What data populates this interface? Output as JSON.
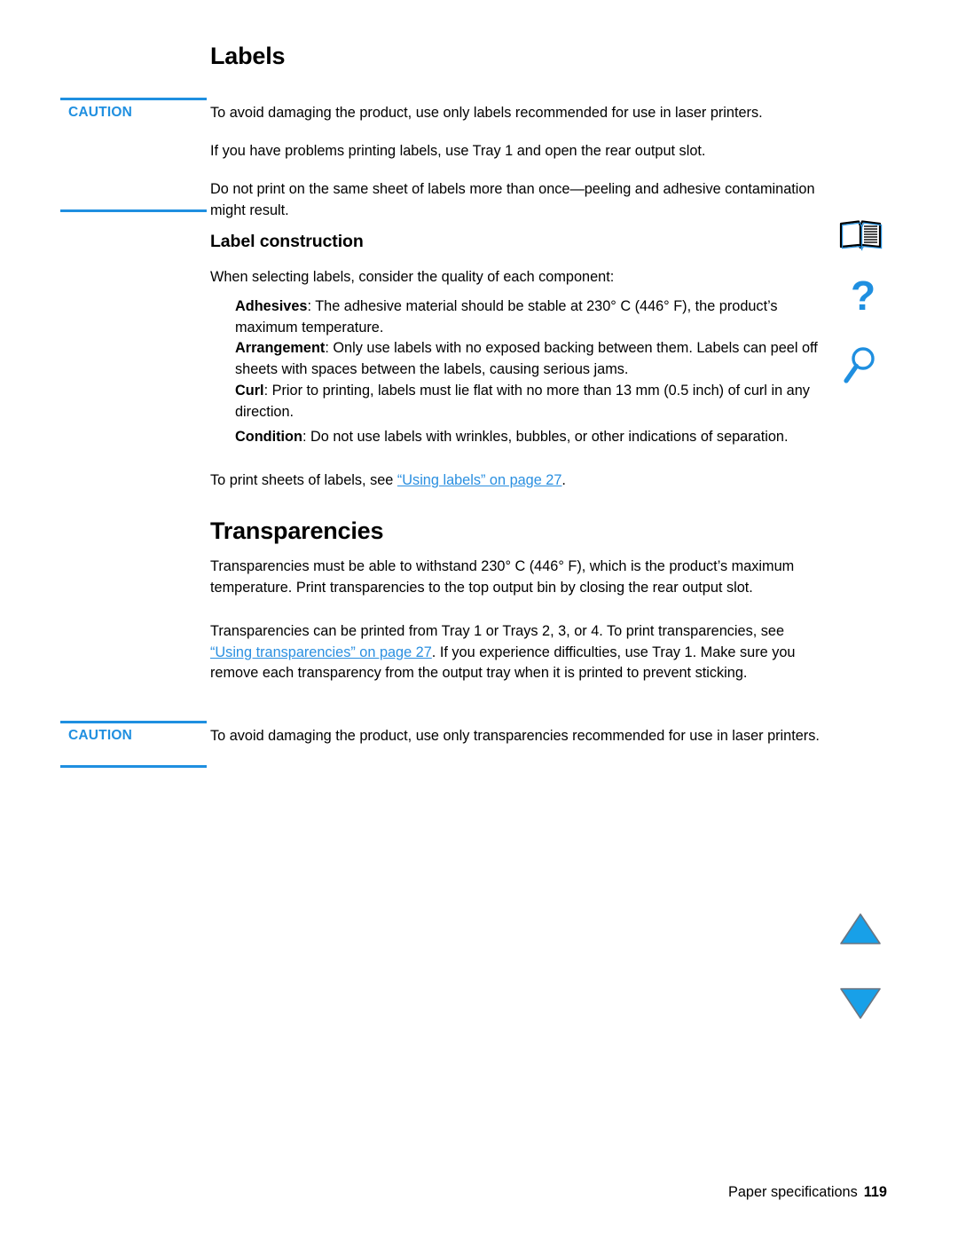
{
  "document": {
    "headings": {
      "labels": "Labels",
      "label_construction": "Label construction",
      "transparencies": "Transparencies"
    },
    "caution": {
      "label": "CAUTION",
      "labels_section_text": "To avoid damaging the product, use only labels recommended for use in laser printers.",
      "transparencies_section_text": "To avoid damaging the product, use only transparencies recommended for use in laser printers."
    },
    "labels_section": {
      "paragraph_tray": "If you have problems printing labels, use Tray 1 and open the rear output slot.",
      "paragraph_reprint": "Do not print on the same sheet of labels more than once—peeling and adhesive contamination might result.",
      "construction_intro": "When selecting labels, consider the quality of each component:",
      "definitions": [
        {
          "term": "Adhesives",
          "text": ": The adhesive material should be stable at 230° C (446° F), the product’s maximum temperature."
        },
        {
          "term": "Arrangement",
          "text": ": Only use labels with no exposed backing between them. Labels can peel off sheets with spaces between the labels, causing serious jams."
        },
        {
          "term": "Curl",
          "text": ": Prior to printing, labels must lie flat with no more than 13 mm (0.5 inch) of curl in any direction."
        },
        {
          "term": "Condition",
          "text": ": Do not use labels with wrinkles, bubbles, or other indications of separation."
        }
      ],
      "cross_reference": {
        "lead_in": "To print sheets of labels, see ",
        "link_text": "“Using labels” on page 27",
        "trailing": "."
      }
    },
    "transparencies_section": {
      "paragraph_temperature": "Transparencies must be able to withstand 230° C (446° F), which is the product’s maximum temperature. Print transparencies to the top output bin by closing the rear output slot.",
      "paragraph_trays": {
        "lead_in": "Transparencies can be printed from Tray 1 or Trays 2, 3, or 4. To print transparencies, see ",
        "link_text": "“Using transparencies” on page 27",
        "trailing": ". If you experience difficulties, use Tray 1. Make sure you remove each transparency from the output tray when it is printed to prevent sticking."
      }
    },
    "footer": {
      "title": "Paper specifications",
      "page_number": "119"
    },
    "nav_icons": [
      {
        "name": "table-of-contents-icon",
        "title": "Table of contents"
      },
      {
        "name": "help-index-icon",
        "title": "Index"
      },
      {
        "name": "search-icon",
        "title": "Search"
      },
      {
        "name": "previous-page-icon",
        "title": "Previous page"
      },
      {
        "name": "next-page-icon",
        "title": "Next page"
      }
    ],
    "colors": {
      "accent_blue": "#1f8fe0",
      "link_blue": "#2a8fe0",
      "text_black": "#000000",
      "page_background": "#ffffff"
    }
  }
}
